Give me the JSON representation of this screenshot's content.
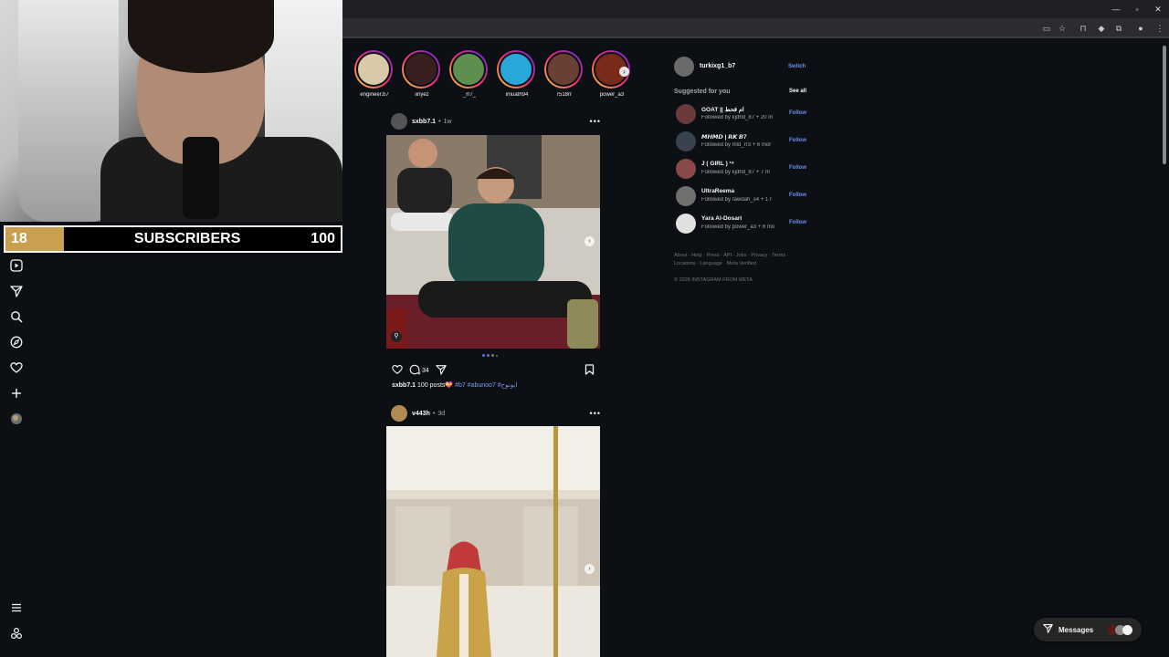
{
  "subscriber_bar": {
    "current": "18",
    "title": "SUBSCRIBERS",
    "goal": "100",
    "progress_fraction": 0.18,
    "fill_color": "#c9a050"
  },
  "left_nav": {
    "icons": [
      "reels-icon",
      "send-icon",
      "search-icon",
      "explore-icon",
      "heart-icon",
      "create-icon",
      "profile-icon",
      "menu-icon",
      "threads-icon"
    ]
  },
  "browser": {
    "window_buttons": [
      "—",
      "▫",
      "✕"
    ],
    "toolbar_icons": [
      "install-icon",
      "star-icon",
      "puzzle-icon",
      "extension-icon",
      "extensions-icon",
      "profile-avatar-icon",
      "kebab-icon"
    ]
  },
  "stories": [
    {
      "name": "engineer.b7",
      "color": "#d9c9a8"
    },
    {
      "name": "iinyez",
      "color": "#3a1f1f"
    },
    {
      "name": "_rr7_",
      "color": "#5f8f4f"
    },
    {
      "name": "imuath94",
      "color": "#2aa7d9"
    },
    {
      "name": "r518rr",
      "color": "#6a3f34"
    },
    {
      "name": "power_a3",
      "color": "#7a2a1a"
    }
  ],
  "posts": [
    {
      "username": "sxbb7.1",
      "age": "1w",
      "caption_user": "sxbb7.1",
      "caption_text": "100 posts💝",
      "hashtags": "#b7 #abunoo7 #ابونوح",
      "comments": "34",
      "avatar_color": "#555555"
    },
    {
      "username": "v443h",
      "age": "3d",
      "avatar_color": "#b08a50"
    }
  ],
  "sidebar": {
    "account": {
      "username": "turkixg1_b7",
      "switch_label": "Switch"
    },
    "suggested_title": "Suggested for you",
    "see_all": "See all",
    "suggestions": [
      {
        "name": "GOAT || ام قحط",
        "followed_by": "Followed by kjdhd_87 + 20 m",
        "follow": "Follow",
        "color": "#6b3a3a"
      },
      {
        "name": "𝙈𝙃𝙈𝘿 | 𝙍𝙆 𝘽7",
        "followed_by": "Followed by mld_rr3 + 6 mor",
        "follow": "Follow",
        "color": "#3a4250"
      },
      {
        "name": "J ( GIRL ) ¹⁸",
        "followed_by": "Followed by kjdhd_87 + 7 m",
        "follow": "Follow",
        "color": "#8a4a4a"
      },
      {
        "name": "UltraReema",
        "followed_by": "Followed by rawdah_s4 + 1 r",
        "follow": "Follow",
        "color": "#707070"
      },
      {
        "name": "Yara Al-Dosari",
        "followed_by": "Followed by power_a3 + 6 mo",
        "follow": "Follow",
        "color": "#e0e0e0"
      }
    ],
    "footer_line1": "About · Help · Press · API · Jobs · Privacy · Terms ·",
    "footer_line2": "Locations · Language · Meta Verified",
    "copyright": "© 2026 INSTAGRAM FROM META"
  },
  "messages": {
    "label": "Messages"
  }
}
